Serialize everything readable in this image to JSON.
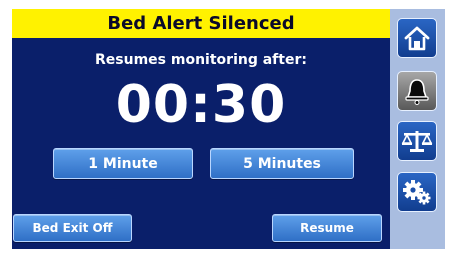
{
  "banner": {
    "title": "Bed Alert Silenced"
  },
  "main": {
    "subtitle": "Resumes monitoring after:",
    "countdown": "00:30",
    "duration_options": [
      "1 Minute",
      "5 Minutes"
    ],
    "bed_exit_label": "Bed Exit Off",
    "resume_label": "Resume"
  },
  "sidebar": {
    "items": [
      {
        "icon": "home-icon",
        "active": false
      },
      {
        "icon": "bell-icon",
        "active": true
      },
      {
        "icon": "scale-icon",
        "active": false
      },
      {
        "icon": "gears-icon",
        "active": false
      }
    ]
  },
  "colors": {
    "banner": "#fff200",
    "background": "#0a1f6a",
    "button": "#3f82d8",
    "sidebar": "#a9bde0"
  }
}
